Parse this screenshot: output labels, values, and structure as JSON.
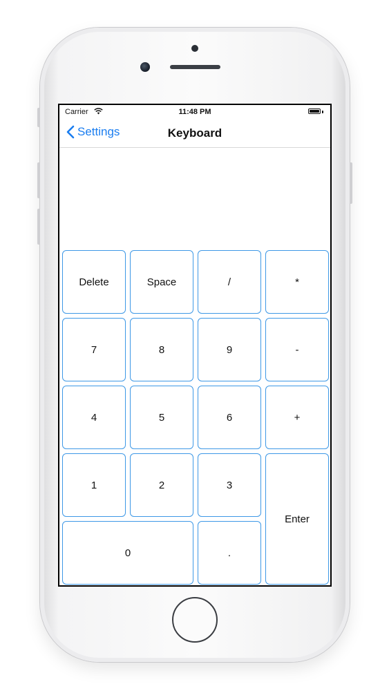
{
  "status_bar": {
    "carrier": "Carrier",
    "time": "11:48 PM",
    "wifi_icon": "wifi-icon",
    "battery_icon": "battery-icon"
  },
  "nav": {
    "back_label": "Settings",
    "back_icon": "chevron-left-icon",
    "title": "Keyboard"
  },
  "keypad": {
    "delete": "Delete",
    "space": "Space",
    "slash": "/",
    "multiply": "*",
    "k7": "7",
    "k8": "8",
    "k9": "9",
    "minus": "-",
    "k4": "4",
    "k5": "5",
    "k6": "6",
    "plus": "+",
    "k1": "1",
    "k2": "2",
    "k3": "3",
    "enter": "Enter",
    "k0": "0",
    "dot": "."
  },
  "colors": {
    "accent": "#1a7df0",
    "key_border": "#3d98e6"
  }
}
